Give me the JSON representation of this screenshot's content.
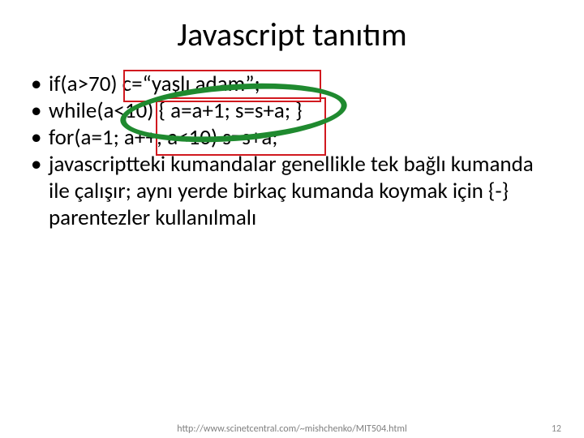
{
  "title": "Javascript tanıtım",
  "bullets": {
    "b1": "if(a>70) c=“yaşlı adam”;",
    "b2": "while(a<10) { a=a+1; s=s+a; }",
    "b3": "for(a=1; a++; a<10) s=s+a;",
    "b4": "javascriptteki kumandalar genellikle tek bağlı kumanda ile çalışır; aynı yerde birkaç kumanda koymak için {-} parentezler kullanılmalı"
  },
  "footer": {
    "url": "http://www.scinetcentral.com/~mishchenko/MIT504.html",
    "page": "12"
  }
}
